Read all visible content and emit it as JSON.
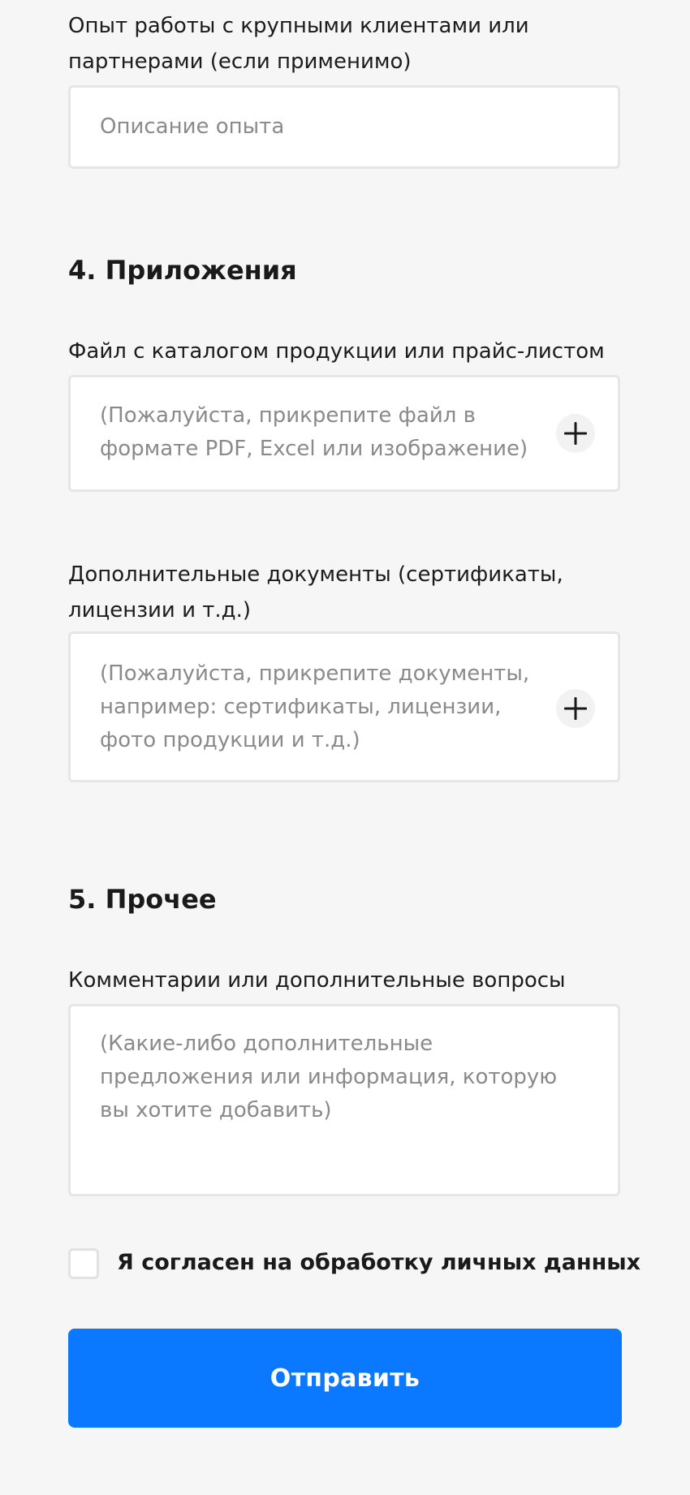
{
  "experience": {
    "label_line1": "Опыт работы с крупными клиентами или",
    "label_line2": "партнерами (если применимо)",
    "placeholder": "Описание опыта"
  },
  "section4": {
    "title": "4. Приложения",
    "catalog": {
      "label": "Файл с каталогом продукции или прайс-листом",
      "hint_line1": "(Пожалуйста, прикрепите файл в",
      "hint_line2": "формате PDF, Excel или изображение)",
      "add_icon": "plus-icon"
    },
    "documents": {
      "label_line1": "Дополнительные документы (сертификаты,",
      "label_line2": "лицензии и т.д.)",
      "hint_line1": "(Пожалуйста, прикрепите документы,",
      "hint_line2": "например: сертификаты, лицензии,",
      "hint_line3": "фото продукции и т.д.)",
      "add_icon": "plus-icon"
    }
  },
  "section5": {
    "title": "5. Прочее",
    "comments": {
      "label": "Комментарии или дополнительные вопросы",
      "placeholder_line1": "(Какие-либо дополнительные",
      "placeholder_line2": "предложения или информация, которую",
      "placeholder_line3": "вы хотите добавить)"
    }
  },
  "consent": {
    "label": "Я согласен на обработку личных данных",
    "checked": false
  },
  "submit": {
    "label": "Отправить"
  },
  "colors": {
    "background": "#f6f6f6",
    "accent": "#0a78ff",
    "field_border": "#e6e6e6",
    "placeholder": "#8a8a8a"
  }
}
